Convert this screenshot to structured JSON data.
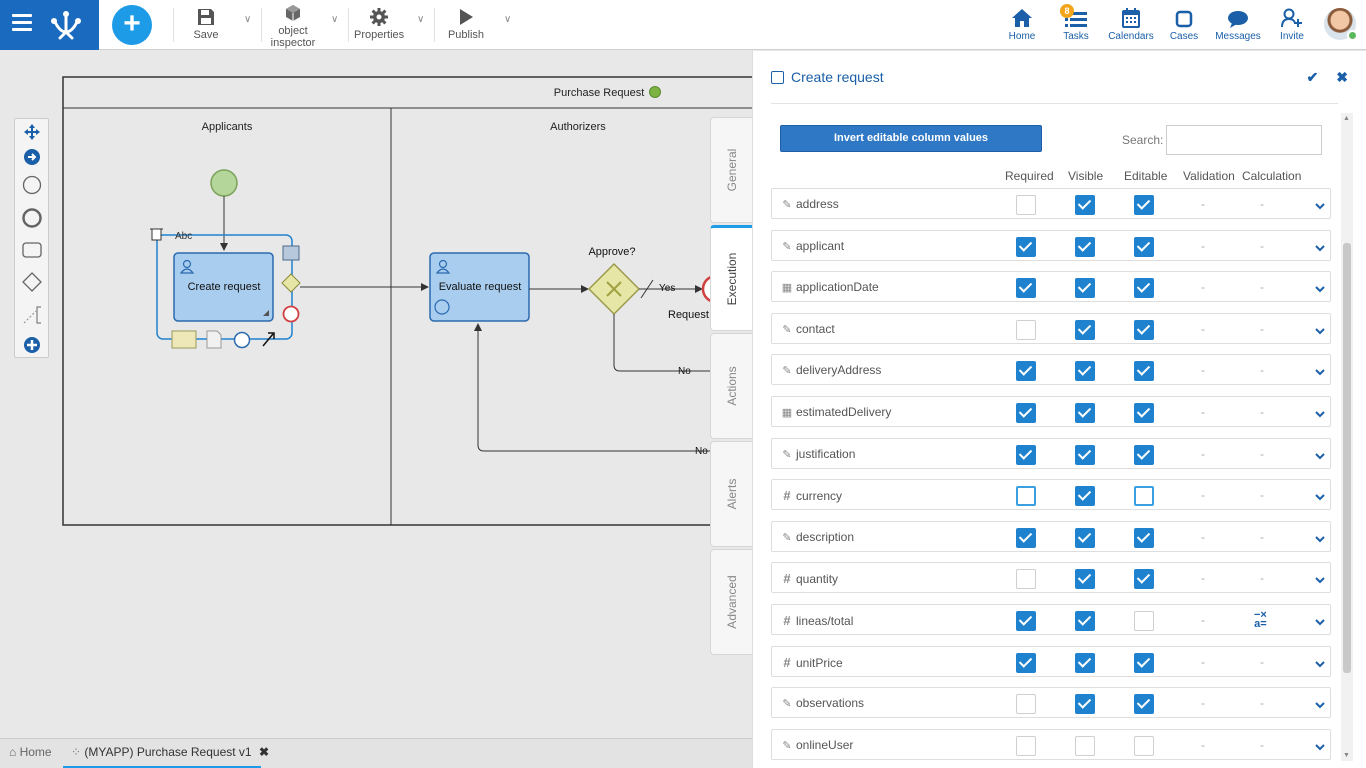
{
  "toolbar": {
    "save": "Save",
    "object_inspector": [
      "object",
      "inspector"
    ],
    "properties": "Properties",
    "publish": "Publish"
  },
  "nav": {
    "home": "Home",
    "tasks": "Tasks",
    "tasks_badge": "8",
    "calendars": "Calendars",
    "cases": "Cases",
    "messages": "Messages",
    "invite": "Invite"
  },
  "diagram": {
    "pool_title": "Purchase Request",
    "lane_1": "Applicants",
    "lane_2": "Authorizers",
    "task_1": "Create request",
    "task_2": "Evaluate request",
    "gateway": "Approve?",
    "flow_yes": "Yes",
    "flow_no_1": "No",
    "flow_no_2": "No",
    "partial_label": "Request",
    "text_tool": "Abc"
  },
  "bottom_tabs": {
    "home": "Home",
    "process": "(MYAPP) Purchase Request v1"
  },
  "side_tabs": [
    "General",
    "Execution",
    "Actions",
    "Alerts",
    "Advanced"
  ],
  "panel": {
    "title": "Create request",
    "invert_button": "Invert editable column values",
    "search_label": "Search:",
    "search_value": "",
    "columns": [
      "Required",
      "Visible",
      "Editable",
      "Validation",
      "Calculation"
    ],
    "rows": [
      {
        "name": "address",
        "icon": "edit-icon",
        "req": "off",
        "vis": "on",
        "edit": "on",
        "val": "-",
        "calc": "-"
      },
      {
        "name": "applicant",
        "icon": "edit-icon",
        "req": "on",
        "vis": "on",
        "edit": "on",
        "val": "-",
        "calc": "-"
      },
      {
        "name": "applicationDate",
        "icon": "calendar-icon",
        "req": "on",
        "vis": "on",
        "edit": "on",
        "val": "-",
        "calc": "-"
      },
      {
        "name": "contact",
        "icon": "edit-icon",
        "req": "off",
        "vis": "on",
        "edit": "on",
        "val": "-",
        "calc": "-"
      },
      {
        "name": "deliveryAddress",
        "icon": "edit-icon",
        "req": "on",
        "vis": "on",
        "edit": "on",
        "val": "-",
        "calc": "-"
      },
      {
        "name": "estimatedDelivery",
        "icon": "calendar-icon",
        "req": "on",
        "vis": "on",
        "edit": "on",
        "val": "-",
        "calc": "-"
      },
      {
        "name": "justification",
        "icon": "edit-icon",
        "req": "on",
        "vis": "on",
        "edit": "on",
        "val": "-",
        "calc": "-"
      },
      {
        "name": "currency",
        "icon": "hash-icon",
        "req": "hl",
        "vis": "on",
        "edit": "hl",
        "val": "-",
        "calc": "-"
      },
      {
        "name": "description",
        "icon": "edit-icon",
        "req": "on",
        "vis": "on",
        "edit": "on",
        "val": "-",
        "calc": "-"
      },
      {
        "name": "quantity",
        "icon": "hash-icon",
        "req": "off",
        "vis": "on",
        "edit": "on",
        "val": "-",
        "calc": "-"
      },
      {
        "name": "lineas/total",
        "icon": "hash-icon",
        "req": "on",
        "vis": "on",
        "edit": "off",
        "val": "-",
        "calc": "formula-icon"
      },
      {
        "name": "unitPrice",
        "icon": "hash-icon",
        "req": "on",
        "vis": "on",
        "edit": "on",
        "val": "-",
        "calc": "-"
      },
      {
        "name": "observations",
        "icon": "edit-icon",
        "req": "off",
        "vis": "on",
        "edit": "on",
        "val": "-",
        "calc": "-"
      },
      {
        "name": "onlineUser",
        "icon": "edit-icon",
        "req": "off",
        "vis": "off",
        "edit": "off",
        "val": "-",
        "calc": "-"
      }
    ]
  },
  "colors": {
    "brand": "#1a6bbf",
    "accent": "#1e9be6",
    "checkbox": "#1f82cf",
    "task_fill": "#a9cdee",
    "gateway_fill": "#e6e6a6",
    "start_event": "#b5d69a",
    "end_event": "#e05050",
    "pool_status": "#7cb342"
  }
}
